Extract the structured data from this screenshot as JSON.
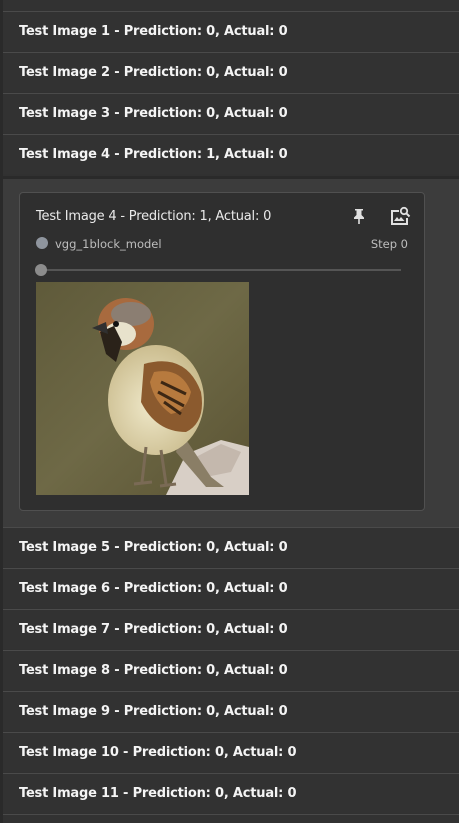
{
  "list": {
    "items": [
      {
        "label": "Test Image 1 - Prediction: 0, Actual: 0"
      },
      {
        "label": "Test Image 2 - Prediction: 0, Actual: 0"
      },
      {
        "label": "Test Image 3 - Prediction: 0, Actual: 0"
      },
      {
        "label": "Test Image 4 - Prediction: 1, Actual: 0"
      },
      {
        "label": "Test Image 5 - Prediction: 0, Actual: 0"
      },
      {
        "label": "Test Image 6 - Prediction: 0, Actual: 0"
      },
      {
        "label": "Test Image 7 - Prediction: 0, Actual: 0"
      },
      {
        "label": "Test Image 8 - Prediction: 0, Actual: 0"
      },
      {
        "label": "Test Image 9 - Prediction: 0, Actual: 0"
      },
      {
        "label": "Test Image 10 - Prediction: 0, Actual: 0"
      },
      {
        "label": "Test Image 11 - Prediction: 0, Actual: 0"
      }
    ]
  },
  "card": {
    "title": "Test Image 4 - Prediction: 1, Actual: 0",
    "run_name": "vgg_1block_model",
    "step_label": "Step 0",
    "pin_icon": "pin-icon",
    "expand_icon": "image-search-icon",
    "run_color": "#8f959e",
    "step_slider_value": 0
  },
  "colors": {
    "background": "#2f2f2f",
    "row_background": "#323232",
    "card_background": "#2f2f2f",
    "divider": "#4a4a4a"
  }
}
